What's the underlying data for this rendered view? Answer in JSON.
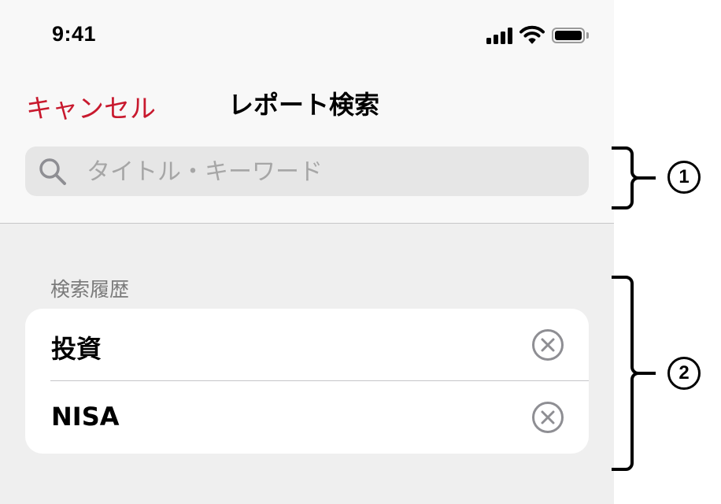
{
  "status_bar": {
    "time": "9:41",
    "icons": [
      "cellular-signal-icon",
      "wifi-icon",
      "battery-icon"
    ]
  },
  "nav": {
    "cancel_label": "キャンセル",
    "title": "レポート検索"
  },
  "search": {
    "placeholder": "タイトル・キーワード",
    "value": "",
    "icon": "search-icon"
  },
  "history": {
    "header": "検索履歴",
    "items": [
      {
        "label": "投資",
        "clear_icon": "clear-icon"
      },
      {
        "label": "NISA",
        "clear_icon": "clear-icon"
      }
    ]
  },
  "annotations": [
    {
      "label": "1"
    },
    {
      "label": "2"
    }
  ],
  "colors": {
    "accent": "#c8192e",
    "background": "#efefef",
    "topbar": "#f8f8f8",
    "search_field": "#e6e6e6",
    "icon_gray": "#8e8e93"
  }
}
